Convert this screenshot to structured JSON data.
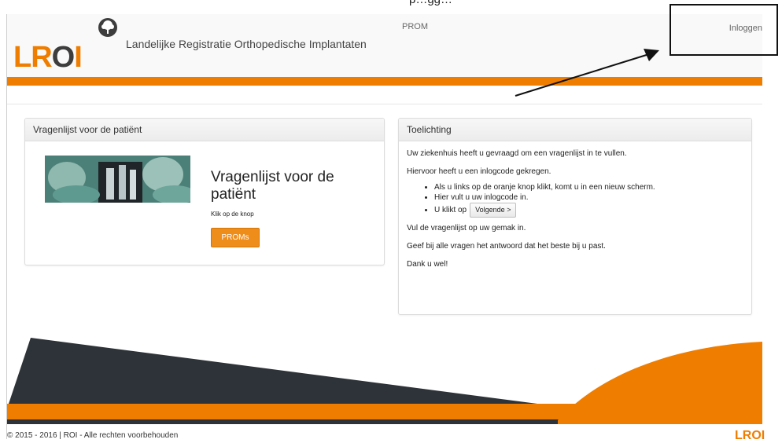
{
  "top_crop_text": "p…gg…",
  "header": {
    "logo_text_l": "LR",
    "logo_text_o": "O",
    "logo_text_i": "I",
    "site_title": "Landelijke Registratie Orthopedische Implantaten",
    "nav_prom": "PROM",
    "nav_login": "Inloggen"
  },
  "left_panel": {
    "heading": "Vragenlijst voor de patiënt",
    "hero_title": "Vragenlijst voor de patiënt",
    "hero_sub": "Klik op de knop",
    "button_label": "PROMs"
  },
  "right_panel": {
    "heading": "Toelichting",
    "para1": "Uw ziekenhuis heeft u gevraagd om een vragenlijst in te vullen.",
    "para2": "Hiervoor heeft u een inlogcode gekregen.",
    "bullet1": "Als u links op de oranje knop klikt, komt u in een nieuw scherm.",
    "bullet2": "Hier vult u uw inlogcode in.",
    "bullet3_prefix": "U klikt op",
    "next_button": "Volgende",
    "next_icon": "chevron-right-icon",
    "para3": "Vul de vragenlijst op uw gemak in.",
    "para4": "Geef bij alle vragen het antwoord dat het beste bij u past.",
    "para5": "Dank u wel!"
  },
  "footer": {
    "copyright": "© 2015 - 2016 | ROI - Alle rechten voorbehouden",
    "logo_text": "LROI"
  },
  "colors": {
    "brand_orange": "#ef7d00",
    "dark_slate": "#2d3338"
  }
}
